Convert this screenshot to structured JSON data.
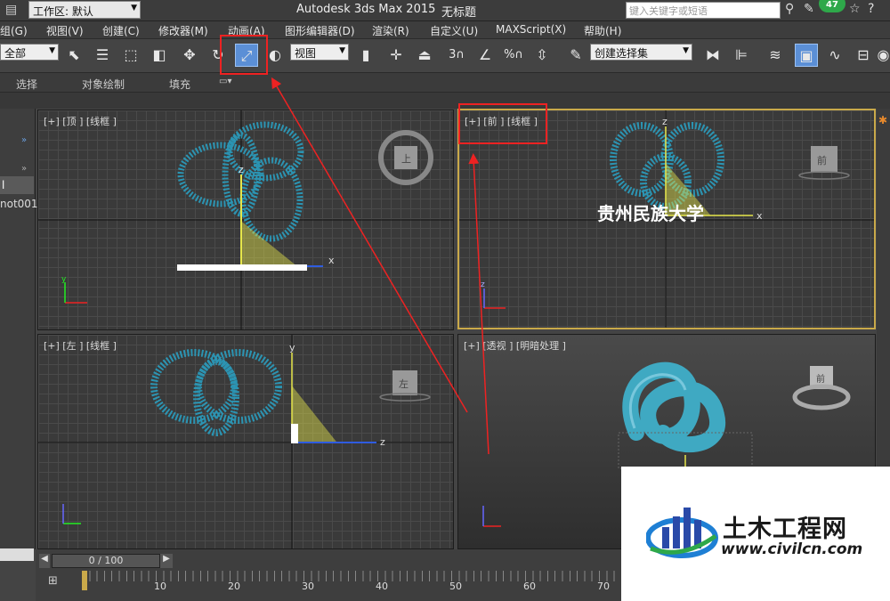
{
  "titlebar": {
    "workspace_label": "工作区: 默认",
    "app_title": "Autodesk 3ds Max  2015",
    "doc_title": "无标题",
    "search_placeholder": "键入关键字或短语",
    "notification_count": "47"
  },
  "menus": [
    "组(G)",
    "视图(V)",
    "创建(C)",
    "修改器(M)",
    "动画(A)",
    "图形编辑器(D)",
    "渲染(R)",
    "自定义(U)",
    "MAXScript(X)",
    "帮助(H)"
  ],
  "toolbar": {
    "filter_value": "全部",
    "refcoord_value": "视图",
    "selset_value": "创建选择集",
    "snap_3": "3",
    "snap_percent": "%"
  },
  "ribbon": {
    "tab_select": "选择",
    "tab_paint": "对象绘制",
    "tab_fill": "填充"
  },
  "left_panel": {
    "item1": "l",
    "item2": "not001"
  },
  "viewports": {
    "top": "[+] [顶 ] [线框 ]",
    "front": "[+] [前 ] [线框 ]",
    "left": "[+] [左 ] [线框 ]",
    "persp": "[+] [透视 ] [明暗处理 ]"
  },
  "viewcube": {
    "top_face": "上",
    "front_face": "前",
    "left_face": "左",
    "persp_face": "前"
  },
  "axis_labels": {
    "x": "x",
    "y": "y",
    "z": "z"
  },
  "overlay_text": "贵州民族大学",
  "timeline": {
    "frame_readout": "0 / 100",
    "ticks": [
      "10",
      "20",
      "30",
      "40",
      "50",
      "60",
      "70"
    ]
  },
  "watermark": {
    "name": "土木工程网",
    "url": "www.civilcn.com"
  },
  "colors": {
    "wire": "#2a9ec0",
    "persp_knot": "#3fa9c2",
    "highlight": "#e22222",
    "active_border": "#c9a94a",
    "gizmo_yellow": "#e6e64a"
  }
}
